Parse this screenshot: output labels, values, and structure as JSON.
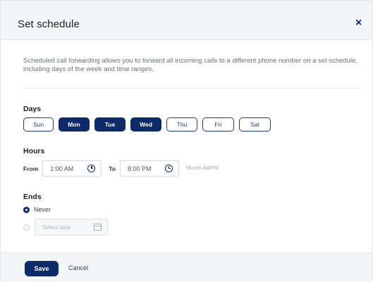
{
  "dialog": {
    "title": "Set schedule",
    "close_glyph": "×",
    "description": "Scheduled call forwarding allows you to forward all incoming calls to a different phone number on a set schedule, including days of the week and time ranges."
  },
  "days_section": {
    "label": "Days",
    "days": [
      {
        "label": "Sun",
        "selected": false
      },
      {
        "label": "Mon",
        "selected": true
      },
      {
        "label": "Tue",
        "selected": true
      },
      {
        "label": "Wed",
        "selected": true
      },
      {
        "label": "Thu",
        "selected": false
      },
      {
        "label": "Fri",
        "selected": false
      },
      {
        "label": "Sat",
        "selected": false
      }
    ]
  },
  "hours_section": {
    "label": "Hours",
    "from_label": "From",
    "from_value": "1:00 AM",
    "to_label": "To",
    "to_value": "8:00 PM",
    "format_hint": "hh:mm AM/PM",
    "icon": "clock-icon"
  },
  "ends_section": {
    "label": "Ends",
    "never_label": "Never",
    "never_selected": true,
    "date_placeholder": "Select date",
    "date_icon": "calendar-icon"
  },
  "footer": {
    "save_label": "Save",
    "cancel_label": "Cancel"
  },
  "colors": {
    "primary": "#0d2b6b",
    "header_bg": "#f4f5f7"
  }
}
